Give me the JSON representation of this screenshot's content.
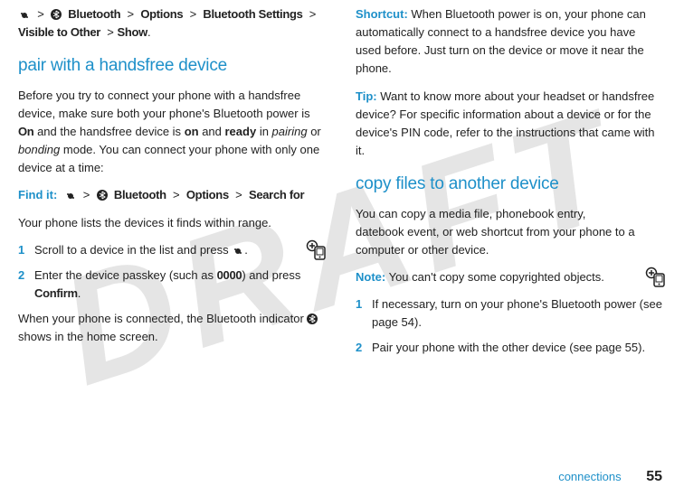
{
  "watermark": "DRAFT",
  "col1": {
    "nav_items": {
      "bt": "Bluetooth",
      "opt": "Options",
      "bts": "Bluetooth Settings",
      "vis": "Visible to Other",
      "show": "Show"
    },
    "gt": ">",
    "heading1": "pair with a handsfree device",
    "p1a": "Before you try to connect your phone with a handsfree device, make sure both your phone's Bluetooth power is ",
    "p1_on_bold": "On",
    "p1b": " and the handsfree device is ",
    "p1_on2": "on",
    "p1c": " and ",
    "p1_ready": "ready",
    "p1d": " in ",
    "p1_pairing": "pairing",
    "p1e": " or ",
    "p1_bonding": "bonding",
    "p1f": " mode. You can connect your phone with only one device at a time:",
    "findit": "Find it:",
    "findit_bt": "Bluetooth",
    "findit_opt": "Options",
    "findit_sf": "Search for",
    "p2": "Your phone lists the devices it finds within range.",
    "s1": "Scroll to a device in the list and press ",
    "s1_end": ".",
    "s2a": "Enter the device passkey (such as ",
    "s2_code": "0000",
    "s2b": ") and press ",
    "s2_confirm": "Confirm",
    "s2c": ".",
    "p3a": "When your phone is connected, the Bluetooth indicator ",
    "p3b": " shows in the home screen."
  },
  "col2": {
    "short_lead": "Shortcut:",
    "short_body": " When Bluetooth power is on, your phone can automatically connect to a handsfree device you have used before. Just turn on the device or move it near the phone.",
    "tip_lead": "Tip:",
    "tip_body": " Want to know more about your headset or handsfree device? For specific information about a device or for the device's PIN code, refer to the instructions that came with it.",
    "heading2": "copy files to another device",
    "p4": "You can copy a media file, phonebook entry, datebook event, or web shortcut from your phone to a computer or other device.",
    "note_lead": "Note:",
    "note_body": " You can't copy some copyrighted objects.",
    "s1": "If necessary, turn on your phone's Bluetooth power (see page 54).",
    "s2": "Pair your phone with the other device (see page 55)."
  },
  "footer": {
    "section": "connections",
    "page": "55"
  }
}
